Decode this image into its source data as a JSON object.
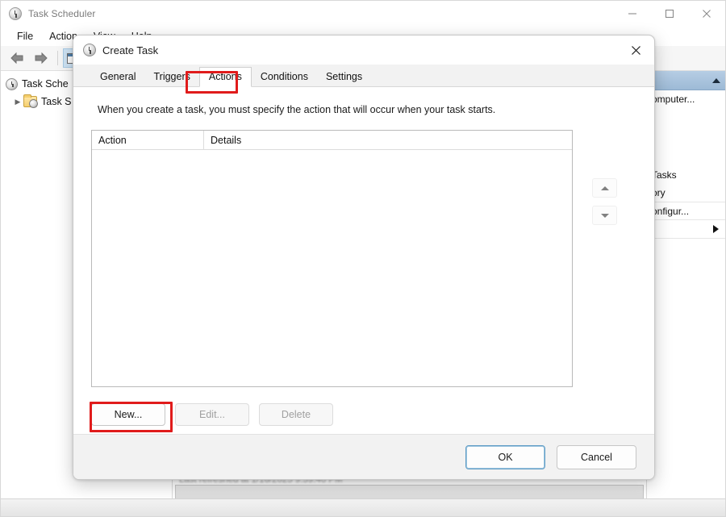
{
  "window": {
    "title": "Task Scheduler",
    "icon": "clock-icon",
    "controls": {
      "minimize": "minimize-icon",
      "maximize": "maximize-icon",
      "close": "close-icon"
    },
    "menu": [
      "File",
      "Action",
      "View",
      "Help"
    ],
    "toolbar": {
      "back": "back-arrow-icon",
      "forward": "forward-arrow-icon",
      "show_hide_console_tree": "console-tree-icon"
    },
    "tree": {
      "root_label": "Task Sche",
      "child_label": "Task S",
      "root_icon": "clock-icon",
      "child_icon": "folder-clock-icon",
      "expander": "chevron-right-icon"
    },
    "list_ghost_text": "Last refreshed at 1/16/2025 9:59:40 PM",
    "actions_pane": {
      "collapse_icon": "caret-up-icon",
      "items": [
        "omputer...",
        "Tasks",
        "ory",
        "onfigur..."
      ],
      "submenu_icon": "caret-right-icon"
    }
  },
  "dialog": {
    "title": "Create Task",
    "icon": "clock-icon",
    "close_icon": "close-icon",
    "tabs": [
      {
        "label": "General",
        "active": false
      },
      {
        "label": "Triggers",
        "active": false
      },
      {
        "label": "Actions",
        "active": true
      },
      {
        "label": "Conditions",
        "active": false
      },
      {
        "label": "Settings",
        "active": false
      }
    ],
    "intro": "When you create a task, you must specify the action that will occur when your task starts.",
    "grid": {
      "columns": [
        "Action",
        "Details"
      ],
      "rows": []
    },
    "reorder": {
      "move_up": "triangle-up-icon",
      "move_down": "triangle-down-icon"
    },
    "buttons": {
      "new": "New...",
      "edit": "Edit...",
      "delete": "Delete",
      "ok": "OK",
      "cancel": "Cancel"
    },
    "highlight_color": "#e01b1b",
    "highlighted": [
      "Actions",
      "New..."
    ]
  }
}
